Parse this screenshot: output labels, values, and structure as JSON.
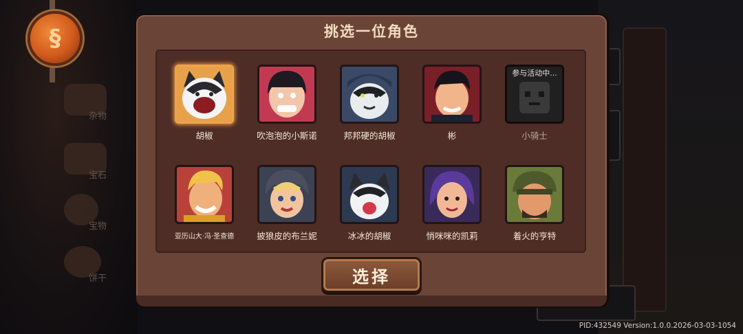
{
  "background": {
    "side_menu": [
      {
        "label": "杂物",
        "icon": "sushi-icon"
      },
      {
        "label": "宝石",
        "icon": "gem-icon"
      },
      {
        "label": "宝物",
        "icon": "relic-icon"
      },
      {
        "label": "饼干",
        "icon": "cookie-icon"
      }
    ]
  },
  "modal": {
    "title": "挑选一位角色",
    "select_label": "选择",
    "characters": [
      {
        "name": "胡椒",
        "selected": true,
        "locked": false
      },
      {
        "name": "吹泡泡的小斯诺",
        "selected": false,
        "locked": false
      },
      {
        "name": "邦邦硬的胡椒",
        "selected": false,
        "locked": false
      },
      {
        "name": "彬",
        "selected": false,
        "locked": false
      },
      {
        "name": "小骑士",
        "selected": false,
        "locked": true,
        "tag": "参与活动中..."
      },
      {
        "name": "亚历山大·冯·圣查德",
        "selected": false,
        "locked": false
      },
      {
        "name": "披狼皮的布兰妮",
        "selected": false,
        "locked": false
      },
      {
        "name": "冰冰的胡椒",
        "selected": false,
        "locked": false
      },
      {
        "name": "悄咪咪的凯莉",
        "selected": false,
        "locked": false
      },
      {
        "name": "着火的亨特",
        "selected": false,
        "locked": false
      }
    ]
  },
  "footer": {
    "build_info": "PID:432549  Version:1.0.0.2026-03-03-1054"
  },
  "colors": {
    "modal_bg": "#6b4438",
    "panel_bg": "#4e2d26",
    "selected_border": "#f2a24a",
    "title_text": "#f1dcc0"
  }
}
